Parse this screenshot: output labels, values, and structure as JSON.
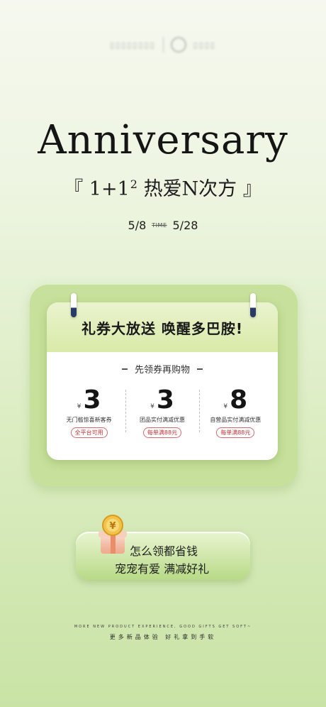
{
  "headline": "Anniversary",
  "subtitle": {
    "open_bracket": "『",
    "prefix": "1+1",
    "sup": "2",
    "suffix": "热爱N次方",
    "close_bracket": "』"
  },
  "dates": {
    "start": "5/8",
    "separator": "TIME",
    "end": "5/28"
  },
  "card": {
    "title": "礼券大放送 唤醒多巴胺!",
    "subtitle": "先领券再购物",
    "coupons": [
      {
        "currency": "¥",
        "amount": "3",
        "desc": "无门槛惊喜新客券",
        "tag": "全平台可用"
      },
      {
        "currency": "¥",
        "amount": "3",
        "desc": "团品实付满减优惠",
        "tag": "每单满88元"
      },
      {
        "currency": "¥",
        "amount": "8",
        "desc": "自营品实付满减优惠",
        "tag": "每单满88元"
      }
    ]
  },
  "promo": {
    "line1": "怎么领都省钱",
    "line2": "宠宠有爱 满减好礼"
  },
  "footer": {
    "en": "MORE NEW PRODUCT EXPERIENCE, GOOD GIFTS GET SOFT~",
    "cn": "更多新品体验 好礼拿到手软"
  },
  "colors": {
    "accent": "#c4343a",
    "card_green": "#c7e09b",
    "ring_dark": "#2a3a66"
  }
}
